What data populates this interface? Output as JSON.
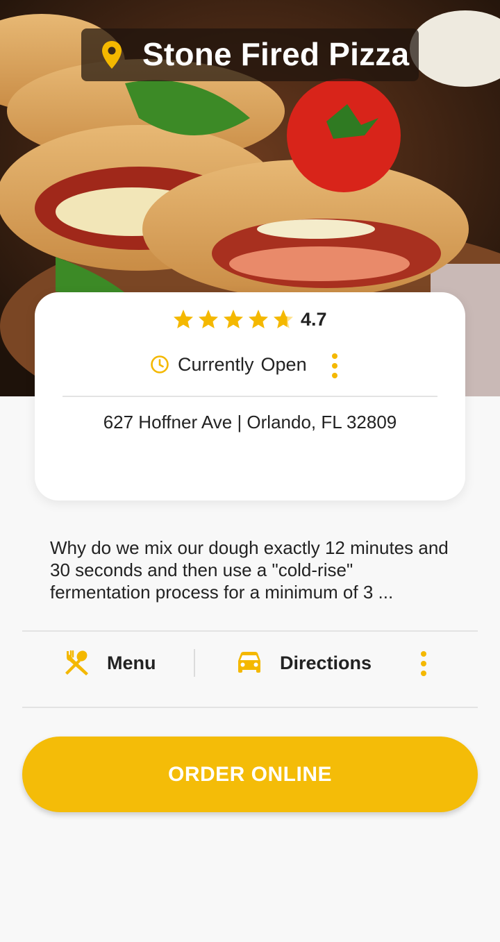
{
  "header": {
    "title": "Stone Fired Pizza",
    "pin_icon": "location-pin-icon",
    "hero_image": "stromboli-photo"
  },
  "info_card": {
    "rating": 4.7,
    "rating_label": "4.7",
    "stars_filled": 4.7,
    "stars_total": 5,
    "hours_label": "Currently",
    "hours_status": "Open",
    "address": "627 Hoffner Ave | Orlando, FL  32809"
  },
  "description": "Why do we mix our dough exactly 12 minutes and 30 seconds and then use a \"cold-rise\" fermentation process for a minimum of 3 ...",
  "actions": {
    "menu_label": "Menu",
    "menu_icon": "fork-spoon-icon",
    "directions_label": "Directions",
    "directions_icon": "car-icon"
  },
  "order_button_label": "ORDER ONLINE",
  "colors": {
    "accent": "#f4bc08",
    "text": "#222222",
    "background": "#f8f8f8"
  }
}
